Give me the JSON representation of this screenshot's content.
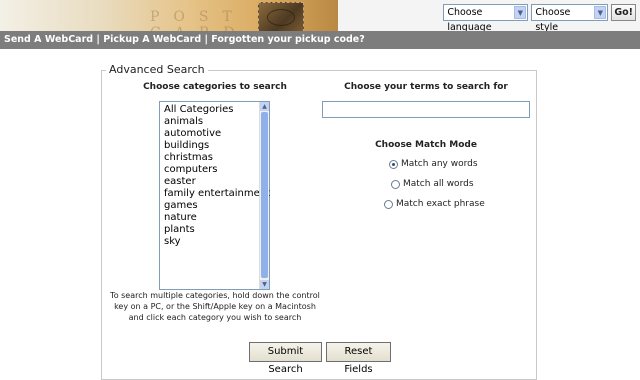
{
  "header": {
    "language_select": "Choose language",
    "style_select": "Choose style",
    "go_label": "Go!"
  },
  "nav": {
    "send": "Send A WebCard",
    "pickup": "Pickup A WebCard",
    "forgotten": "Forgotten your pickup code?",
    "separator": "|"
  },
  "search": {
    "legend": "Advanced Search",
    "categories_heading": "Choose categories to search",
    "categories": [
      "All Categories",
      "animals",
      "automotive",
      "buildings",
      "christmas",
      "computers",
      "easter",
      "family entertainment",
      "games",
      "nature",
      "plants",
      "sky"
    ],
    "hint": "To search multiple categories, hold down the control key on a PC, or the Shift/Apple key on a Macintosh and click each category you wish to search",
    "terms_heading": "Choose your terms to search for",
    "terms_value": "",
    "match_heading": "Choose Match Mode",
    "match_modes": [
      {
        "label": "Match any words",
        "selected": true
      },
      {
        "label": "Match all words",
        "selected": false
      },
      {
        "label": "Match exact phrase",
        "selected": false
      }
    ],
    "submit_label": "Submit Search",
    "reset_label": "Reset Fields"
  }
}
